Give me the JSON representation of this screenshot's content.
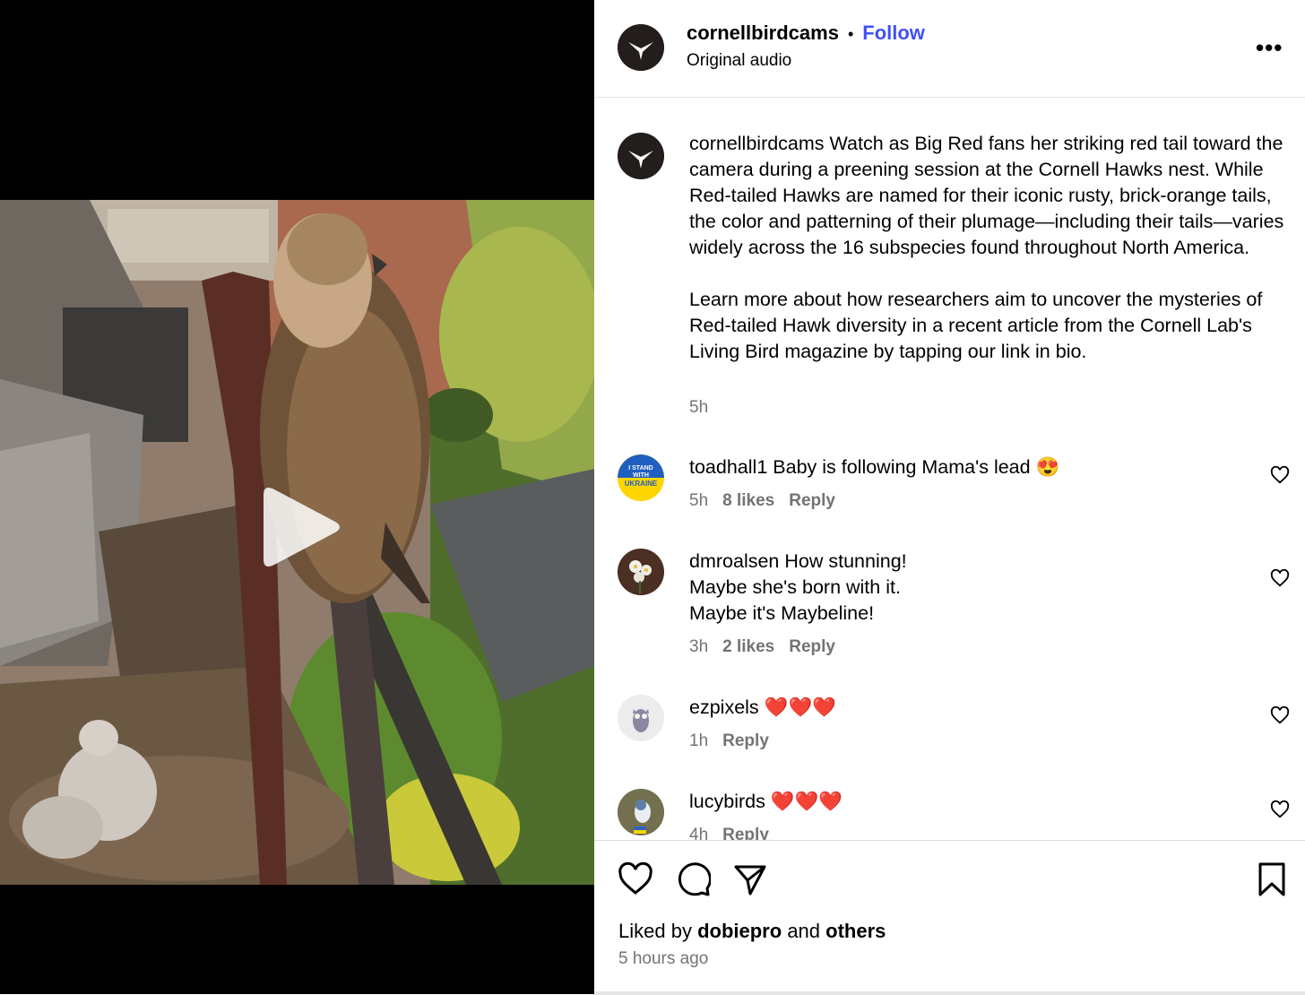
{
  "post": {
    "username": "cornellbirdcams",
    "dot": "•",
    "follow_label": "Follow",
    "subtitle": "Original audio",
    "more_label": "•••"
  },
  "caption": {
    "username": "cornellbirdcams",
    "paragraph1": "Watch as Big Red fans her striking red tail toward the camera during a preening session at the Cornell Hawks nest. While Red-tailed Hawks are named for their iconic rusty, brick-orange tails, the color and patterning of their plumage—including their tails—varies widely across the 16 subspecies found throughout North America.",
    "paragraph2": "Learn more about how researchers aim to uncover the mysteries of Red-tailed Hawk diversity in a recent article from the Cornell Lab's Living Bird magazine by tapping our link in bio.",
    "time": "5h"
  },
  "comments": [
    {
      "username": "toadhall1",
      "lines": [
        "Baby is following Mama's lead 😍"
      ],
      "time": "5h",
      "likes": "8 likes",
      "reply": "Reply"
    },
    {
      "username": "dmroalsen",
      "lines": [
        "How stunning!",
        "Maybe she's born with it.",
        "Maybe it's Maybeline!"
      ],
      "time": "3h",
      "likes": "2 likes",
      "reply": "Reply"
    },
    {
      "username": "ezpixels",
      "lines": [
        "❤️❤️❤️"
      ],
      "time": "1h",
      "reply": "Reply"
    },
    {
      "username": "lucybirds",
      "lines": [
        "❤️❤️❤️"
      ],
      "time": "4h",
      "reply": "Reply"
    }
  ],
  "footer": {
    "liked_prefix": "Liked by",
    "liked_user": "dobiepro",
    "liked_and": "and",
    "liked_others": "others",
    "time_ago": "5 hours ago"
  },
  "avatar_badges": {
    "toadhall1": [
      "I STAND",
      "WITH",
      "UKRAINE"
    ]
  },
  "colors": {
    "follow": "#4150f7",
    "muted": "#737373",
    "avatar_dark": "#231e1b"
  }
}
